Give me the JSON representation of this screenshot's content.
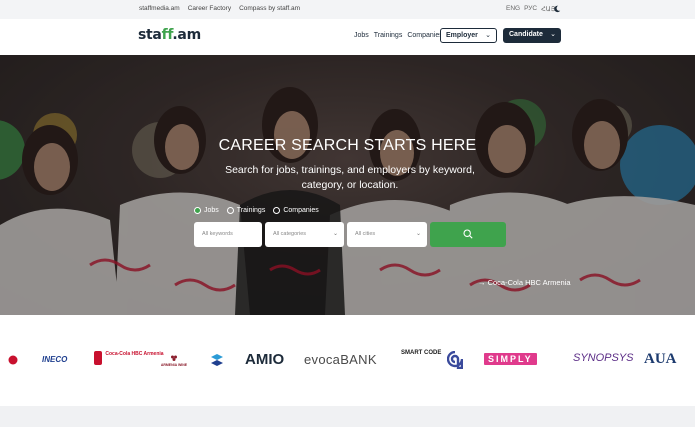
{
  "topbar": {
    "links": [
      "staffmedia.am",
      "Career Factory",
      "Compass by staff.am"
    ],
    "languages": [
      "ENG",
      "РУС",
      "ՀԱՅ"
    ],
    "theme_icon": "moon-icon"
  },
  "header": {
    "logo_prefix": "sta",
    "logo_mid": "ff",
    "logo_suffix": ".am",
    "nav": [
      "Jobs",
      "Trainings",
      "Companies"
    ],
    "employer_label": "Employer",
    "candidate_label": "Candidate"
  },
  "hero": {
    "title": "CAREER SEARCH STARTS HERE",
    "subtitle": "Search for jobs, trainings, and employers by keyword, category, or location.",
    "radios": [
      {
        "label": "Jobs",
        "checked": true
      },
      {
        "label": "Trainings",
        "checked": false
      },
      {
        "label": "Companies",
        "checked": false
      }
    ],
    "keywords_placeholder": "All keywords",
    "categories_value": "All categories",
    "cities_value": "All cities",
    "search_icon": "search-icon",
    "credit": "→ Coca-Cola HBC Armenia"
  },
  "partners": [
    {
      "name": "INECO",
      "color": "#1f3f8f"
    },
    {
      "name": "Coca-Cola HBC Armenia",
      "color": "#c8102e"
    },
    {
      "name": "ARMENIA WINE",
      "color": "#8a1c2b"
    },
    {
      "name": "AMIO",
      "color": "#1d2b3a"
    },
    {
      "name": "evocaBANK",
      "color": "#4a4a4a"
    },
    {
      "name": "SMART CODE",
      "color": "#1d1d1d"
    },
    {
      "name": "SIMPLY",
      "color": "#e03a8c"
    },
    {
      "name": "SYNOPSYS",
      "color": "#5b2c86"
    },
    {
      "name": "AUA",
      "color": "#1c3a6e"
    }
  ],
  "colors": {
    "brand_green": "#3fa34d",
    "navy": "#1d2b3a"
  }
}
